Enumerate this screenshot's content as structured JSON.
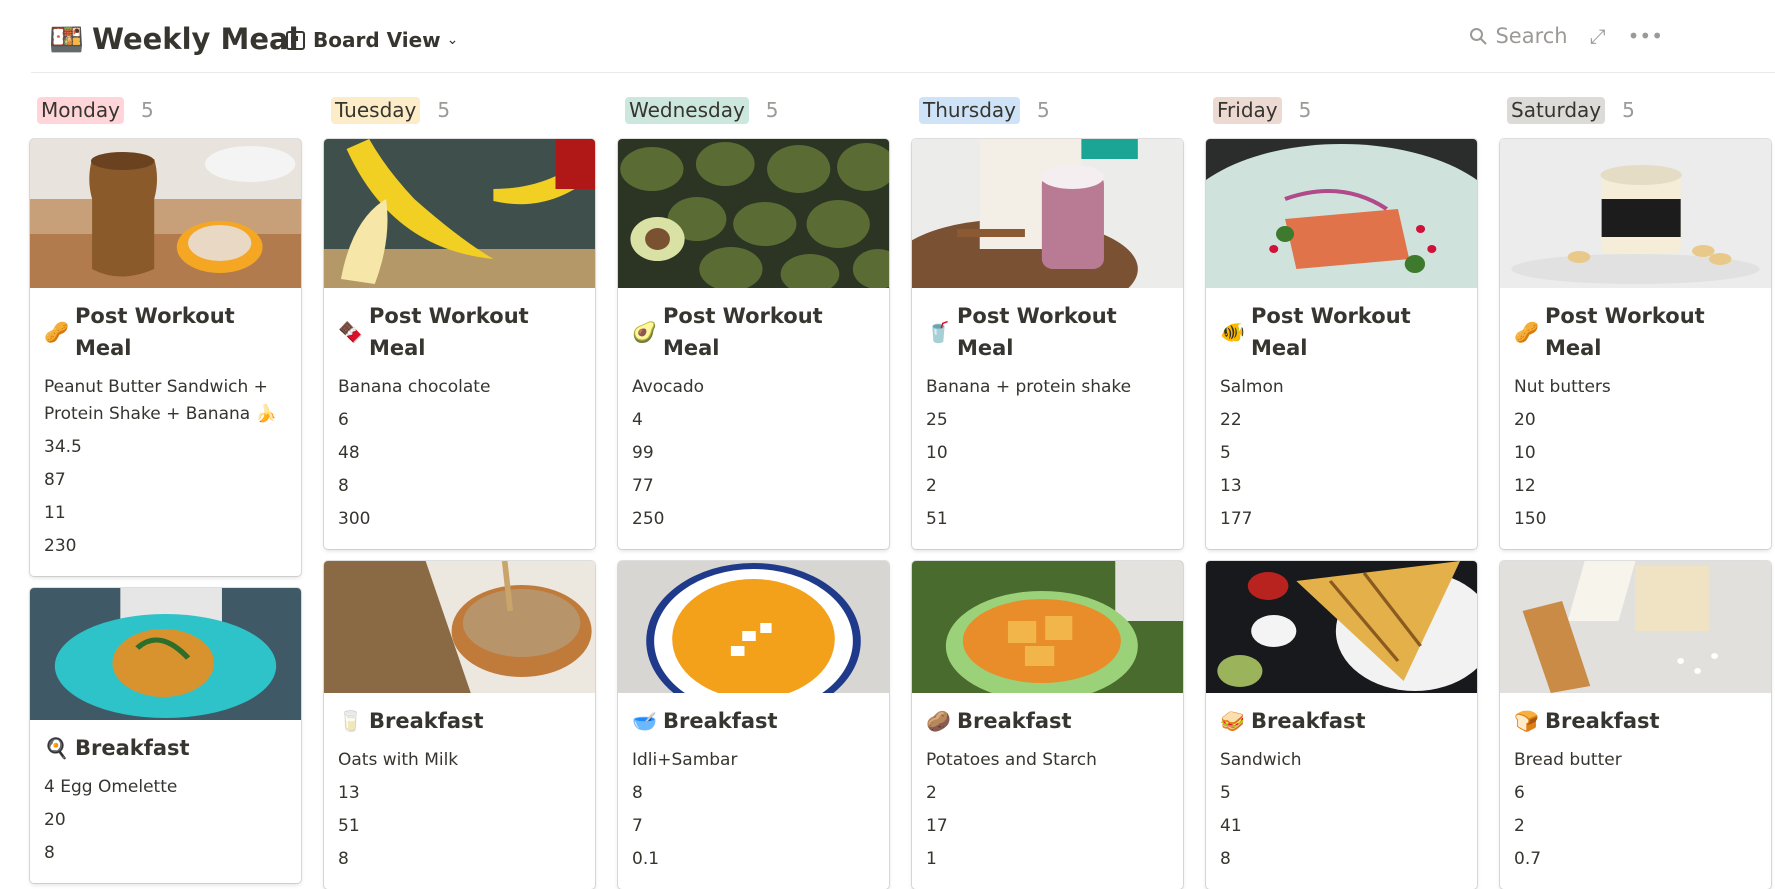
{
  "header": {
    "page_icon": "🍱",
    "title": "Weekly Meal",
    "view_label": "Board View",
    "search_label": "Search"
  },
  "columns": [
    {
      "name": "Monday",
      "count": "5",
      "tag_color": "#ffd5d9",
      "cards": [
        {
          "emoji": "🥜",
          "title": "Post Workout Meal",
          "food": "Peanut Butter Sandwich + Protein Shake + Banana 🍌",
          "values": [
            "34.5",
            "87",
            "11",
            "230"
          ],
          "cover": "peanut-butter-jar"
        },
        {
          "emoji": "🍳",
          "title": "Breakfast",
          "food": "4 Egg Omelette",
          "values": [
            "20",
            "8"
          ],
          "cover": "omelette-plate"
        }
      ]
    },
    {
      "name": "Tuesday",
      "count": "5",
      "tag_color": "#fcecc8",
      "cards": [
        {
          "emoji": "🍫",
          "title": "Post Workout Meal",
          "food": "Banana chocolate",
          "values": [
            "6",
            "48",
            "8",
            "300"
          ],
          "cover": "bananas"
        },
        {
          "emoji": "🥛",
          "title": "Breakfast",
          "food": "Oats with Milk",
          "values": [
            "13",
            "51",
            "8"
          ],
          "cover": "oats-bowl"
        }
      ]
    },
    {
      "name": "Wednesday",
      "count": "5",
      "tag_color": "#cce8de",
      "cards": [
        {
          "emoji": "🥑",
          "title": "Post Workout Meal",
          "food": "Avocado",
          "values": [
            "4",
            "99",
            "77",
            "250"
          ],
          "cover": "avocados"
        },
        {
          "emoji": "🥣",
          "title": "Breakfast",
          "food": "Idli+Sambar",
          "values": [
            "8",
            "7",
            "0.1"
          ],
          "cover": "soup-bowl"
        }
      ]
    },
    {
      "name": "Thursday",
      "count": "5",
      "tag_color": "#cfe3f8",
      "cards": [
        {
          "emoji": "🥤",
          "title": "Post Workout Meal",
          "food": "Banana + protein shake",
          "values": [
            "25",
            "10",
            "2",
            "51"
          ],
          "cover": "protein-shake"
        },
        {
          "emoji": "🥔",
          "title": "Breakfast",
          "food": "Potatoes and Starch",
          "values": [
            "2",
            "17",
            "1"
          ],
          "cover": "potato-bowl"
        }
      ]
    },
    {
      "name": "Friday",
      "count": "5",
      "tag_color": "#ecd9d1",
      "cards": [
        {
          "emoji": "🐠",
          "title": "Post Workout Meal",
          "food": "Salmon",
          "values": [
            "22",
            "5",
            "13",
            "177"
          ],
          "cover": "salmon-plate"
        },
        {
          "emoji": "🥪",
          "title": "Breakfast",
          "food": "Sandwich",
          "values": [
            "5",
            "41",
            "8"
          ],
          "cover": "sandwich"
        }
      ]
    },
    {
      "name": "Saturday",
      "count": "5",
      "tag_color": "#dcdbd8",
      "cards": [
        {
          "emoji": "🥜",
          "title": "Post Workout Meal",
          "food": "Nut butters",
          "values": [
            "20",
            "10",
            "12",
            "150"
          ],
          "cover": "cashew-butter-jar"
        },
        {
          "emoji": "🍞",
          "title": "Breakfast",
          "food": "Bread butter",
          "values": [
            "6",
            "2",
            "0.7"
          ],
          "cover": "bread-cheese"
        }
      ]
    }
  ]
}
